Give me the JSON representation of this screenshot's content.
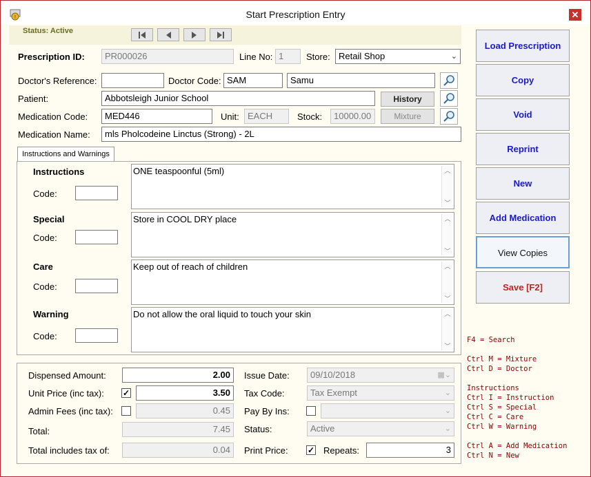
{
  "window": {
    "title": "Start Prescription Entry",
    "close_label": "✕"
  },
  "status": {
    "text": "Status: Active"
  },
  "nav": {
    "first": "first-record",
    "prev": "previous-record",
    "next": "next-record",
    "last": "last-record"
  },
  "form": {
    "prescription_id_label": "Prescription ID:",
    "prescription_id": "PR000026",
    "line_no_label": "Line No:",
    "line_no": "1",
    "store_label": "Store:",
    "store": "Retail Shop",
    "doctor_ref_label": "Doctor's Reference:",
    "doctor_ref": "",
    "doctor_code_label": "Doctor Code:",
    "doctor_code": "SAM",
    "doctor_name": "Samu",
    "patient_label": "Patient:",
    "patient": "Abbotsleigh Junior School",
    "history_label": "History",
    "medication_code_label": "Medication Code:",
    "medication_code": "MED446",
    "unit_label": "Unit:",
    "unit": "EACH",
    "stock_label": "Stock:",
    "stock": "10000.00",
    "mixture_label": "Mixture",
    "medication_name_label": "Medication Name:",
    "medication_name": "mls Pholcodeine Linctus (Strong) - 2L"
  },
  "tab": {
    "label": "Instructions and Warnings"
  },
  "instructions": [
    {
      "title": "Instructions",
      "code_label": "Code:",
      "text": "ONE teaspoonful (5ml)"
    },
    {
      "title": "Special",
      "code_label": "Code:",
      "text": "Store in COOL DRY place"
    },
    {
      "title": "Care",
      "code_label": "Code:",
      "text": "Keep out of reach of children"
    },
    {
      "title": "Warning",
      "code_label": "Code:",
      "text": "Do not allow the oral liquid to touch your skin"
    }
  ],
  "totals": {
    "dispensed_label": "Dispensed Amount:",
    "dispensed": "2.00",
    "unit_price_label": "Unit Price (inc tax):",
    "unit_price": "3.50",
    "admin_label": "Admin Fees (inc tax):",
    "admin": "0.45",
    "total_label": "Total:",
    "total": "7.45",
    "tax_included_label": "Total includes tax of:",
    "tax_included": "0.04",
    "issue_date_label": "Issue Date:",
    "issue_date": "09/10/2018",
    "tax_code_label": "Tax Code:",
    "tax_code": "Tax Exempt",
    "pay_by_ins_label": "Pay By Ins:",
    "status_label": "Status:",
    "status_value": "Active",
    "print_price_label": "Print Price:",
    "repeats_label": "Repeats:",
    "repeats": "3"
  },
  "side_buttons": {
    "load": "Load Prescription",
    "copy": "Copy",
    "void": "Void",
    "reprint": "Reprint",
    "new": "New",
    "add_med": "Add Medication",
    "view_copies": "View Copies",
    "save": "Save [F2]"
  },
  "hotkeys": {
    "l1": "F4 = Search",
    "l2": "Ctrl M = Mixture",
    "l3": "Ctrl D = Doctor",
    "l4": "Instructions",
    "l5": "Ctrl I = Instruction",
    "l6": "Ctrl S = Special",
    "l7": "Ctrl C = Care",
    "l8": "Ctrl W = Warning",
    "l9": "Ctrl A = Add Medication",
    "l10": "Ctrl N = New"
  },
  "colors": {
    "frame": "#b3272c",
    "link_blue": "#1a1ac8",
    "save_red": "#c41e1e",
    "hotkey_red": "#8b0000"
  }
}
